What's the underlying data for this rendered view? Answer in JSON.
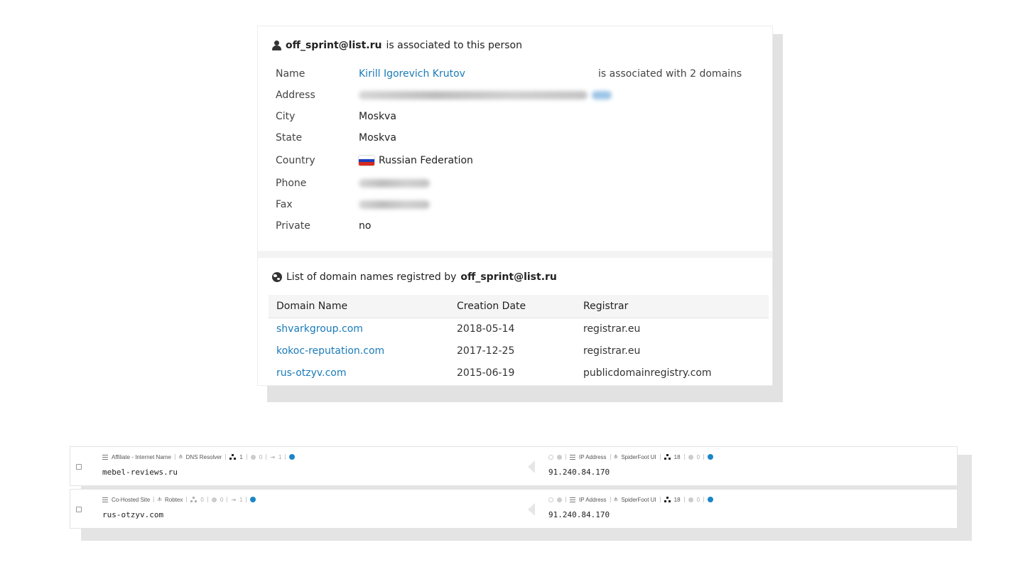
{
  "person_card": {
    "title_email": "off_sprint@list.ru",
    "title_suffix": "is associated to this person",
    "assoc_note": "is associated with 2 domains",
    "fields": {
      "name_label": "Name",
      "name_value": "Kirill Igorevich Krutov",
      "address_label": "Address",
      "city_label": "City",
      "city_value": "Moskva",
      "state_label": "State",
      "state_value": "Moskva",
      "country_label": "Country",
      "country_value": "Russian Federation",
      "phone_label": "Phone",
      "fax_label": "Fax",
      "private_label": "Private",
      "private_value": "no"
    }
  },
  "domains_card": {
    "title_prefix": "List of domain names registred by",
    "title_email": "off_sprint@list.ru",
    "columns": [
      "Domain Name",
      "Creation Date",
      "Registrar"
    ],
    "rows": [
      {
        "domain": "shvarkgroup.com",
        "date": "2018-05-14",
        "registrar": "registrar.eu"
      },
      {
        "domain": "kokoc-reputation.com",
        "date": "2017-12-25",
        "registrar": "registrar.eu"
      },
      {
        "domain": "rus-otzyv.com",
        "date": "2015-06-19",
        "registrar": "publicdomainregistry.com"
      }
    ]
  },
  "spiderfoot": {
    "rows": [
      {
        "left": {
          "type": "Affiliate - Internet Name",
          "module": "DNS Resolver",
          "children": "1",
          "c2": "0",
          "c3": "1",
          "value": "mebel-reviews.ru"
        },
        "right": {
          "type": "IP Address",
          "module": "SpiderFoot UI",
          "children": "18",
          "c2": "0",
          "value": "91.240.84.170"
        }
      },
      {
        "left": {
          "type": "Co-Hosted Site",
          "module": "Robtex",
          "children": "0",
          "c2": "0",
          "c3": "1",
          "value": "rus-otzyv.com"
        },
        "right": {
          "type": "IP Address",
          "module": "SpiderFoot UI",
          "children": "18",
          "c2": "0",
          "value": "91.240.84.170"
        }
      }
    ]
  }
}
